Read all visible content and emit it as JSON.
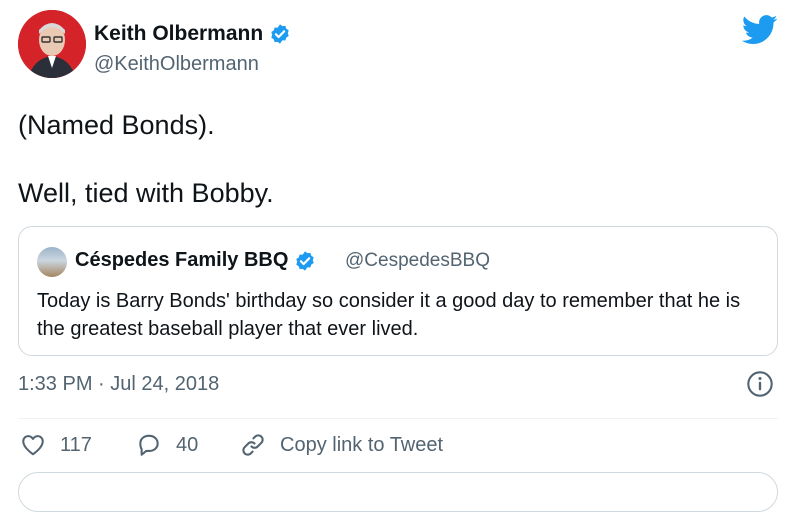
{
  "author": {
    "name": "Keith Olbermann",
    "handle": "@KeithOlbermann",
    "verified": true
  },
  "tweet": {
    "lines": [
      "(Named Bonds).",
      "Well, tied with Bobby."
    ]
  },
  "quote": {
    "name": "Céspedes Family BBQ",
    "handle": "@CespedesBBQ",
    "verified": true,
    "text": "Today is Barry Bonds' birthday so consider it a good day to remember that he is the greatest baseball player that ever lived."
  },
  "timestamp": "1:33 PM · Jul 24, 2018",
  "actions": {
    "like_count": "117",
    "reply_count": "40",
    "copy_link_label": "Copy link to Tweet"
  },
  "icons": {
    "brand": "twitter-bird-icon",
    "verified": "verified-badge-icon",
    "info": "info-icon",
    "like": "heart-icon",
    "reply": "reply-bubble-icon",
    "copy": "link-icon"
  },
  "colors": {
    "brand_blue": "#1d9bf0",
    "text_primary": "#0f1419",
    "text_secondary": "#536471",
    "border": "#cfd9de",
    "avatar_red": "#d4242a"
  }
}
